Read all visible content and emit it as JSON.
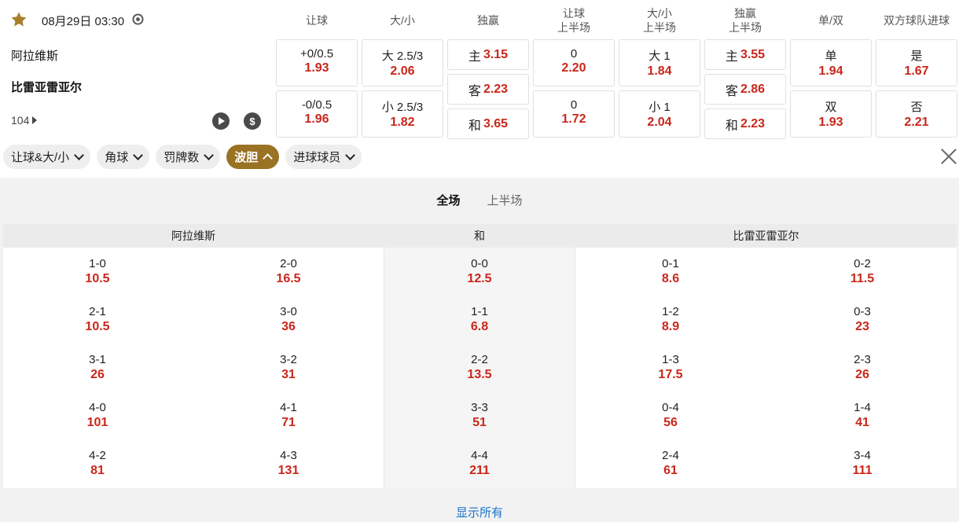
{
  "match": {
    "datetime": "08月29日 03:30",
    "home": "阿拉维斯",
    "away": "比雷亚雷亚尔",
    "id": "104"
  },
  "market_headers": [
    [
      "让球"
    ],
    [
      "大/小"
    ],
    [
      "独赢"
    ],
    [
      "让球",
      "上半场"
    ],
    [
      "大/小",
      "上半场"
    ],
    [
      "独赢",
      "上半场"
    ],
    [
      "单/双"
    ],
    [
      "双方球队进球"
    ]
  ],
  "odds": {
    "handicap": [
      {
        "label": "+0/0.5",
        "value": "1.93"
      },
      {
        "label": "-0/0.5",
        "value": "1.96"
      }
    ],
    "over_under": [
      {
        "label": "大 2.5/3",
        "value": "2.06"
      },
      {
        "label": "小 2.5/3",
        "value": "1.82"
      }
    ],
    "moneyline": [
      {
        "label": "主",
        "value": "3.15"
      },
      {
        "label": "客",
        "value": "2.23"
      },
      {
        "label": "和",
        "value": "3.65"
      }
    ],
    "handicap_1h": [
      {
        "label": "0",
        "value": "2.20"
      },
      {
        "label": "0",
        "value": "1.72"
      }
    ],
    "over_under_1h": [
      {
        "label": "大 1",
        "value": "1.84"
      },
      {
        "label": "小 1",
        "value": "2.04"
      }
    ],
    "moneyline_1h": [
      {
        "label": "主",
        "value": "3.55"
      },
      {
        "label": "客",
        "value": "2.86"
      },
      {
        "label": "和",
        "value": "2.23"
      }
    ],
    "odd_even": [
      {
        "label": "单",
        "value": "1.94"
      },
      {
        "label": "双",
        "value": "1.93"
      }
    ],
    "btts": [
      {
        "label": "是",
        "value": "1.67"
      },
      {
        "label": "否",
        "value": "2.21"
      }
    ]
  },
  "chips": [
    "让球&大/小",
    "角球",
    "罚牌数",
    "波胆",
    "进球球员"
  ],
  "active_chip": "波胆",
  "period_tabs": [
    "全场",
    "上半场"
  ],
  "correct_score": {
    "headers": {
      "home": "阿拉维斯",
      "draw": "和",
      "away": "比雷亚雷亚尔"
    },
    "columns": [
      [
        {
          "s": "1-0",
          "o": "10.5"
        },
        {
          "s": "2-1",
          "o": "10.5"
        },
        {
          "s": "3-1",
          "o": "26"
        },
        {
          "s": "4-0",
          "o": "101"
        },
        {
          "s": "4-2",
          "o": "81"
        }
      ],
      [
        {
          "s": "2-0",
          "o": "16.5"
        },
        {
          "s": "3-0",
          "o": "36"
        },
        {
          "s": "3-2",
          "o": "31"
        },
        {
          "s": "4-1",
          "o": "71"
        },
        {
          "s": "4-3",
          "o": "131"
        }
      ],
      [
        {
          "s": "0-0",
          "o": "12.5"
        },
        {
          "s": "1-1",
          "o": "6.8"
        },
        {
          "s": "2-2",
          "o": "13.5"
        },
        {
          "s": "3-3",
          "o": "51"
        },
        {
          "s": "4-4",
          "o": "211"
        }
      ],
      [
        {
          "s": "0-1",
          "o": "8.6"
        },
        {
          "s": "1-2",
          "o": "8.9"
        },
        {
          "s": "1-3",
          "o": "17.5"
        },
        {
          "s": "0-4",
          "o": "56"
        },
        {
          "s": "2-4",
          "o": "61"
        }
      ],
      [
        {
          "s": "0-2",
          "o": "11.5"
        },
        {
          "s": "0-3",
          "o": "23"
        },
        {
          "s": "2-3",
          "o": "26"
        },
        {
          "s": "1-4",
          "o": "41"
        },
        {
          "s": "3-4",
          "o": "111"
        }
      ]
    ]
  },
  "show_all": "显示所有",
  "colors": {
    "odds_red": "#c9271b",
    "gold": "#9a7224",
    "link_blue": "#1a73c9"
  }
}
